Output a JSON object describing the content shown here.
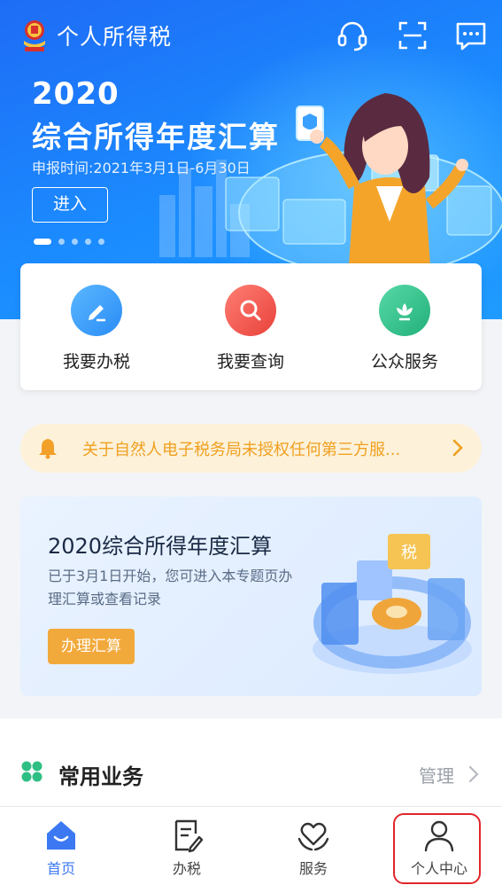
{
  "app": {
    "title": "个人所得税"
  },
  "topbar_icons": [
    "headset-icon",
    "scan-icon",
    "message-icon"
  ],
  "hero": {
    "year": "2020",
    "title": "综合所得年度汇算",
    "date_text": "申报时间:2021年3月1日-6月30日",
    "enter_label": "进入",
    "carousel_count": 5,
    "carousel_active": 0
  },
  "quick_actions": [
    {
      "label": "我要办税",
      "icon": "pen-icon",
      "color": "#3aa0ff"
    },
    {
      "label": "我要查询",
      "icon": "magnifier-icon",
      "color": "#f25a52"
    },
    {
      "label": "公众服务",
      "icon": "lotus-icon",
      "color": "#31c48d"
    }
  ],
  "notice": {
    "text": "关于自然人电子税务局未授权任何第三方服...",
    "icon": "bell-icon",
    "color": "#f0a020"
  },
  "promo": {
    "title": "2020综合所得年度汇算",
    "description": "已于3月1日开始，您可进入本专题页办理汇算或查看记录",
    "button_label": "办理汇算",
    "illus_tag": "税"
  },
  "common": {
    "title": "常用业务",
    "manage_label": "管理"
  },
  "tabs": [
    {
      "label": "首页",
      "icon": "home-icon",
      "active": true
    },
    {
      "label": "办税",
      "icon": "document-edit-icon",
      "active": false
    },
    {
      "label": "服务",
      "icon": "heart-hands-icon",
      "active": false
    },
    {
      "label": "个人中心",
      "icon": "person-icon",
      "active": false,
      "highlighted": true
    }
  ],
  "colors": {
    "brand_blue": "#1e6cf5",
    "tab_active": "#3b78f2",
    "promo_button": "#f2a93b",
    "highlight_border": "#e0262b"
  }
}
